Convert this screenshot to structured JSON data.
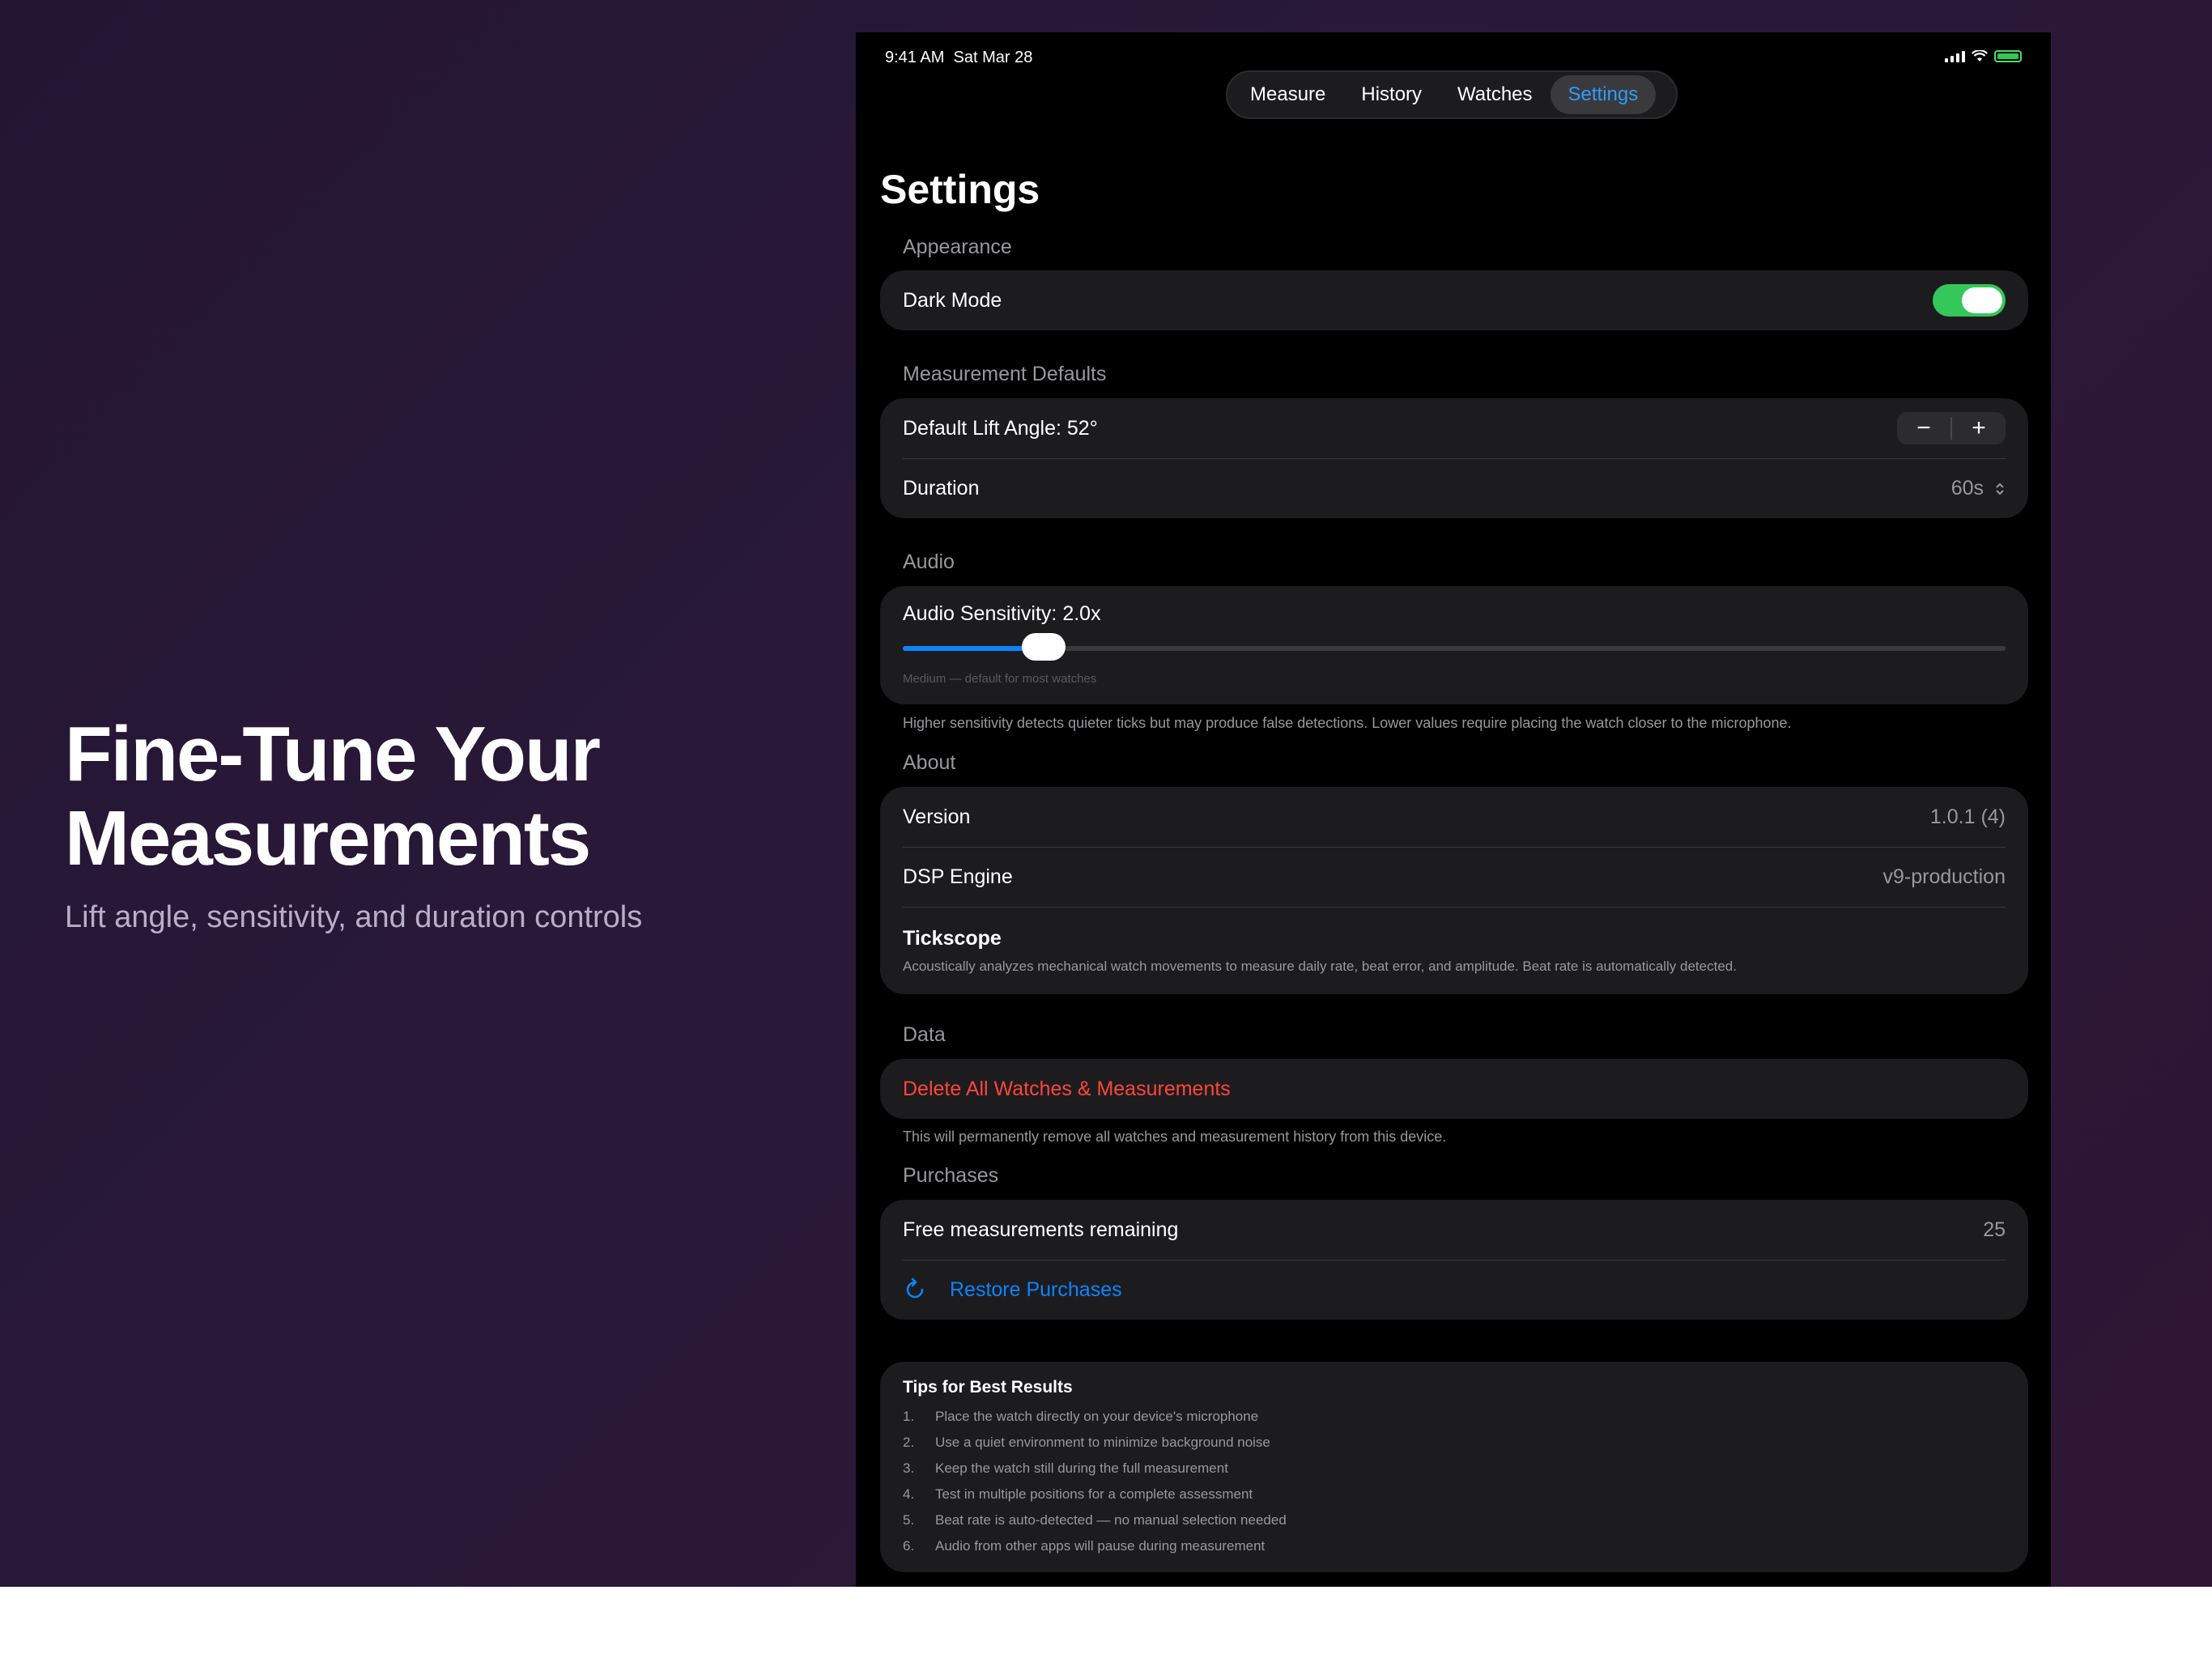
{
  "marketing": {
    "headline_line1": "Fine-Tune Your",
    "headline_line2": "Measurements",
    "subline": "Lift angle, sensitivity, and duration controls"
  },
  "status_bar": {
    "time": "9:41 AM",
    "date": "Sat Mar 28"
  },
  "tabs": [
    {
      "label": "Measure",
      "active": false
    },
    {
      "label": "History",
      "active": false
    },
    {
      "label": "Watches",
      "active": false
    },
    {
      "label": "Settings",
      "active": true
    }
  ],
  "page_title": "Settings",
  "appearance": {
    "label": "Appearance",
    "dark_mode_label": "Dark Mode",
    "dark_mode_on": true
  },
  "measurement_defaults": {
    "label": "Measurement Defaults",
    "lift_angle_label": "Default Lift Angle: 52°",
    "stepper_minus": "−",
    "stepper_plus": "+",
    "duration_label": "Duration",
    "duration_value": "60s"
  },
  "audio": {
    "label": "Audio",
    "sensitivity_label": "Audio Sensitivity: 2.0x",
    "sensitivity_fraction": 0.128,
    "hint": "Medium — default for most watches",
    "footnote": "Higher sensitivity detects quieter ticks but may produce false detections. Lower values require placing the watch closer to the microphone."
  },
  "about": {
    "label": "About",
    "version_label": "Version",
    "version_value": "1.0.1 (4)",
    "dsp_label": "DSP Engine",
    "dsp_value": "v9-production",
    "app_name": "Tickscope",
    "app_description": "Acoustically analyzes mechanical watch movements to measure daily rate, beat error, and amplitude. Beat rate is automatically detected."
  },
  "data": {
    "label": "Data",
    "delete_label": "Delete All Watches & Measurements",
    "footnote": "This will permanently remove all watches and measurement history from this device."
  },
  "purchases": {
    "label": "Purchases",
    "free_label": "Free measurements remaining",
    "free_value": "25",
    "restore_label": "Restore Purchases"
  },
  "tips": {
    "title": "Tips for Best Results",
    "items": [
      {
        "n": "1.",
        "text": "Place the watch directly on your device's microphone"
      },
      {
        "n": "2.",
        "text": "Use a quiet environment to minimize background noise"
      },
      {
        "n": "3.",
        "text": "Keep the watch still during the full measurement"
      },
      {
        "n": "4.",
        "text": "Test in multiple positions for a complete assessment"
      },
      {
        "n": "5.",
        "text": "Beat rate is auto-detected — no manual selection needed"
      },
      {
        "n": "6.",
        "text": "Audio from other apps will pause during measurement"
      }
    ]
  },
  "colors": {
    "accent_blue": "#0a84ff",
    "toggle_green": "#34c759",
    "destructive_red": "#ff453a"
  }
}
